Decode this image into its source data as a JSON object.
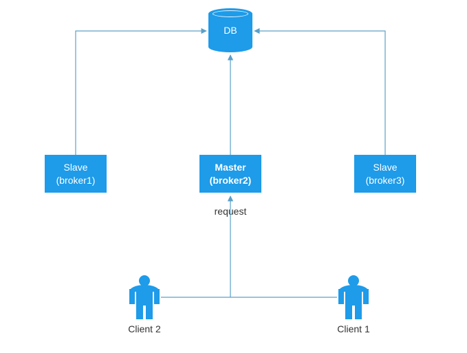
{
  "colors": {
    "primary": "#1e9be9",
    "line": "#5aa0c8",
    "text": "#333333"
  },
  "db": {
    "label": "DB"
  },
  "brokers": {
    "slave1": {
      "title": "Slave",
      "sub": "(broker1)"
    },
    "master": {
      "title": "Master",
      "sub": "(broker2)"
    },
    "slave3": {
      "title": "Slave",
      "sub": "(broker3)"
    }
  },
  "labels": {
    "request": "request"
  },
  "clients": {
    "client2": "Client 2",
    "client1": "Client 1"
  },
  "chart_data": {
    "type": "diagram",
    "title": "",
    "nodes": [
      {
        "id": "db",
        "kind": "database",
        "label": "DB"
      },
      {
        "id": "broker1",
        "kind": "broker",
        "role": "Slave",
        "label": "Slave (broker1)"
      },
      {
        "id": "broker2",
        "kind": "broker",
        "role": "Master",
        "label": "Master (broker2)"
      },
      {
        "id": "broker3",
        "kind": "broker",
        "role": "Slave",
        "label": "Slave (broker3)"
      },
      {
        "id": "client1",
        "kind": "client",
        "label": "Client 1"
      },
      {
        "id": "client2",
        "kind": "client",
        "label": "Client 2"
      }
    ],
    "edges": [
      {
        "from": "broker1",
        "to": "db",
        "directed": true
      },
      {
        "from": "broker2",
        "to": "db",
        "directed": true
      },
      {
        "from": "broker3",
        "to": "db",
        "directed": true
      },
      {
        "from": "client1",
        "to": "broker2",
        "directed": true,
        "label": "request"
      },
      {
        "from": "client2",
        "to": "broker2",
        "directed": true,
        "label": "request"
      }
    ]
  }
}
